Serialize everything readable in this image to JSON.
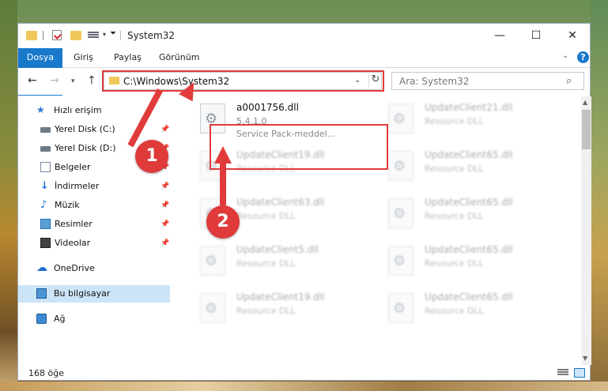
{
  "window": {
    "title": "System32",
    "controls": {
      "minimize": "—",
      "maximize": "☐",
      "close": "✕"
    }
  },
  "ribbon": {
    "tabs": [
      "Dosya",
      "Giriş",
      "Paylaş",
      "Görünüm"
    ],
    "help": "?"
  },
  "address": {
    "path": "C:\\Windows\\System32",
    "refresh_icon": "↻"
  },
  "search": {
    "placeholder": "Ara: System32"
  },
  "sidebar": {
    "items": [
      {
        "label": "Hızlı erişim",
        "icon": "star-icon"
      },
      {
        "label": "Yerel Disk (C:)",
        "icon": "drive-icon",
        "pinned": true
      },
      {
        "label": "Yerel Disk (D:)",
        "icon": "drive-icon",
        "pinned": true
      },
      {
        "label": "Belgeler",
        "icon": "documents-icon",
        "pinned": true
      },
      {
        "label": "İndirmeler",
        "icon": "download-icon",
        "pinned": true
      },
      {
        "label": "Müzik",
        "icon": "music-icon",
        "pinned": true
      },
      {
        "label": "Resimler",
        "icon": "pictures-icon",
        "pinned": true
      },
      {
        "label": "Videolar",
        "icon": "video-icon",
        "pinned": true
      },
      {
        "label": "OneDrive",
        "icon": "cloud-icon"
      },
      {
        "label": "Bu bilgisayar",
        "icon": "computer-icon",
        "selected": true
      },
      {
        "label": "Ağ",
        "icon": "network-icon"
      }
    ]
  },
  "files": [
    {
      "name": "a0001756.dll",
      "line2": "5.4.1.0",
      "line3": "Service Pack-meddel...",
      "highlighted": true
    },
    {
      "name": "UpdateClient21.dll",
      "line2": "Resource DLL"
    },
    {
      "name": "UpdateClient19.dll",
      "line2": "Resource DLL"
    },
    {
      "name": "UpdateClient65.dll",
      "line2": "Resource DLL"
    },
    {
      "name": "UpdateClient63.dll",
      "line2": "Resource DLL"
    },
    {
      "name": "UpdateClient65.dll",
      "line2": "Resource DLL"
    },
    {
      "name": "UpdateClient5.dll",
      "line2": "Resource DLL"
    },
    {
      "name": "UpdateClient65.dll",
      "line2": "Resource DLL"
    },
    {
      "name": "UpdateClient19.dll",
      "line2": "Resource DLL"
    },
    {
      "name": "UpdateClient65.dll",
      "line2": "Resource DLL"
    }
  ],
  "status": {
    "item_count": "168 öğe"
  },
  "callouts": [
    "1",
    "2"
  ],
  "colors": {
    "accent": "#1979ca",
    "highlight_red": "#e03c3c",
    "selected_bg": "#cce4f7"
  }
}
